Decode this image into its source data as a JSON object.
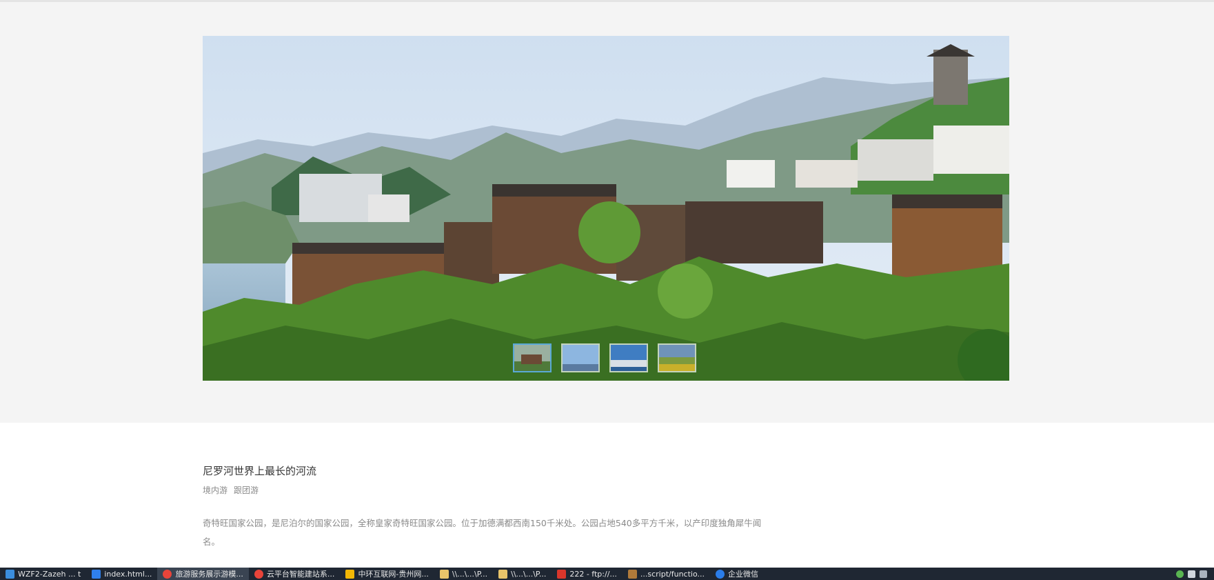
{
  "hero": {
    "image_description_icon": "landscape-photo",
    "thumbnails": [
      {
        "name": "thumb-village",
        "active": true
      },
      {
        "name": "thumb-sky",
        "active": false
      },
      {
        "name": "thumb-city",
        "active": false
      },
      {
        "name": "thumb-field",
        "active": false
      }
    ]
  },
  "article": {
    "title": "尼罗河世界上最长的河流",
    "tags": [
      "境内游",
      "跟团游"
    ],
    "description": "奇特旺国家公园，是尼泊尔的国家公园，全称皇家奇特旺国家公园。位于加德满都西南150千米处。公园占地540多平方千米，以产印度独角犀牛闻名。"
  },
  "taskbar": {
    "items": [
      {
        "label": "WZF2-Zazeh ... t",
        "color": "#3b8ede",
        "active": false
      },
      {
        "label": "index.html...",
        "color": "#2f80ed",
        "active": false
      },
      {
        "label": "旅游服务展示游模...",
        "color": "#e8443a",
        "active": true
      },
      {
        "label": "云平台智能建站系...",
        "color": "#e8443a",
        "active": false
      },
      {
        "label": "中环互联网-贵州网...",
        "color": "#f2b705",
        "active": false
      },
      {
        "label": "\\\\...\\...\\P...",
        "color": "#e8c46a",
        "active": false
      },
      {
        "label": "\\\\...\\...\\P...",
        "color": "#e8c46a",
        "active": false
      },
      {
        "label": "222 - ftp://...",
        "color": "#d9362b",
        "active": false
      },
      {
        "label": "...script/functio...",
        "color": "#b07a3a",
        "active": false
      },
      {
        "label": "企业微信",
        "color": "#2b7de9",
        "active": false
      }
    ]
  },
  "colors": {
    "band_bg": "#f4f4f4",
    "title_text": "#333333",
    "muted_text": "#8a8a8a",
    "taskbar_bg": "#1f2733"
  }
}
